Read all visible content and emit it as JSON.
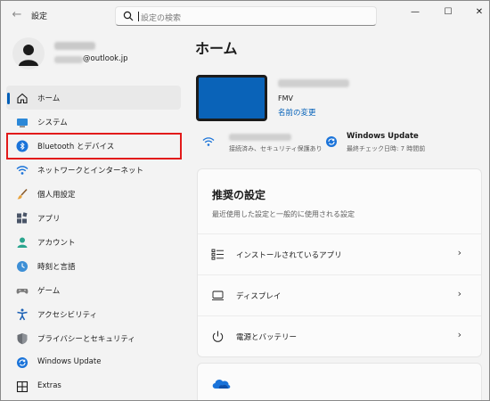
{
  "app": {
    "title": "設定"
  },
  "search": {
    "placeholder": "設定の検索"
  },
  "profile": {
    "email_suffix": "@outlook.jp"
  },
  "nav": {
    "items": [
      {
        "label": "ホーム",
        "icon": "home-icon",
        "active": true
      },
      {
        "label": "システム",
        "icon": "system-icon"
      },
      {
        "label": "Bluetooth とデバイス",
        "icon": "bluetooth-icon"
      },
      {
        "label": "ネットワークとインターネット",
        "icon": "wifi-icon"
      },
      {
        "label": "個人用設定",
        "icon": "brush-icon"
      },
      {
        "label": "アプリ",
        "icon": "apps-icon"
      },
      {
        "label": "アカウント",
        "icon": "account-icon"
      },
      {
        "label": "時刻と言語",
        "icon": "time-language-icon"
      },
      {
        "label": "ゲーム",
        "icon": "game-controller-icon"
      },
      {
        "label": "アクセシビリティ",
        "icon": "accessibility-icon"
      },
      {
        "label": "プライバシーとセキュリティ",
        "icon": "shield-icon"
      },
      {
        "label": "Windows Update",
        "icon": "windows-update-icon"
      },
      {
        "label": "Extras",
        "icon": "extras-icon"
      }
    ]
  },
  "main": {
    "title": "ホーム",
    "device": {
      "model": "FMV",
      "rename_label": "名前の変更"
    },
    "network": {
      "sub": "接続済み、セキュリティ保護あり"
    },
    "update": {
      "title": "Windows Update",
      "sub": "最終チェック日時: 7 時間前"
    },
    "recommended": {
      "title": "推奨の設定",
      "desc": "最近使用した設定と一般的に使用される設定",
      "items": [
        {
          "label": "インストールされているアプリ",
          "icon": "installed-apps-icon"
        },
        {
          "label": "ディスプレイ",
          "icon": "display-icon"
        },
        {
          "label": "電源とバッテリー",
          "icon": "power-icon"
        }
      ]
    }
  },
  "colors": {
    "accent": "#005fb8",
    "highlight": "#e21a1a",
    "device": "#0a63b8"
  }
}
